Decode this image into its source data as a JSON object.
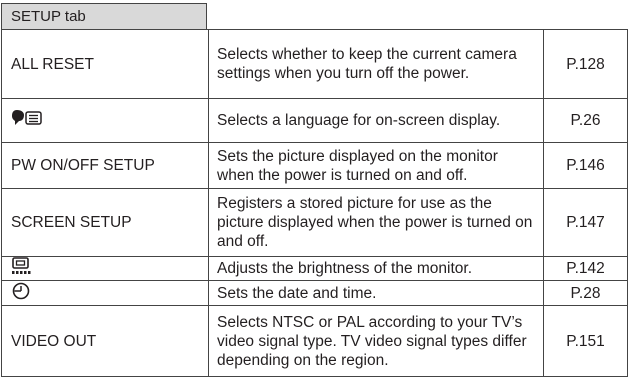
{
  "tab": {
    "label": "SETUP tab"
  },
  "rows": [
    {
      "name": "ALL RESET",
      "icon": null,
      "desc": "Selects whether to keep the current camera settings when you turn off the power.",
      "page": "P.128"
    },
    {
      "name": "",
      "icon": "language-icon",
      "desc": "Selects a language for on-screen display.",
      "page": "P.26"
    },
    {
      "name": "PW ON/OFF SETUP",
      "icon": null,
      "desc": "Sets the picture displayed on the monitor when the power is turned on and off.",
      "page": "P.146"
    },
    {
      "name": "SCREEN SETUP",
      "icon": null,
      "desc": "Registers a stored picture for use as the picture displayed when the power is turned on and off.",
      "page": "P.147"
    },
    {
      "name": "",
      "icon": "monitor-brightness-icon",
      "desc": "Adjusts the brightness of the monitor.",
      "page": "P.142"
    },
    {
      "name": "",
      "icon": "clock-icon",
      "desc": "Sets the date and time.",
      "page": "P.28"
    },
    {
      "name": "VIDEO OUT",
      "icon": null,
      "desc": "Selects NTSC or PAL according to your TV’s video signal type. TV video signal types differ depending on the region.",
      "page": "P.151"
    }
  ]
}
